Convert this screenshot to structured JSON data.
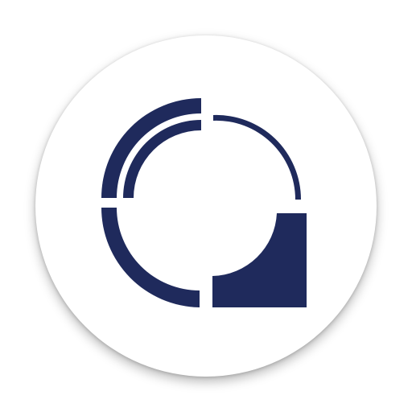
{
  "app_icon": {
    "icon": "app-logo-icon",
    "badge_color": "#ffffff",
    "logo_color": "#1f2a5c"
  }
}
